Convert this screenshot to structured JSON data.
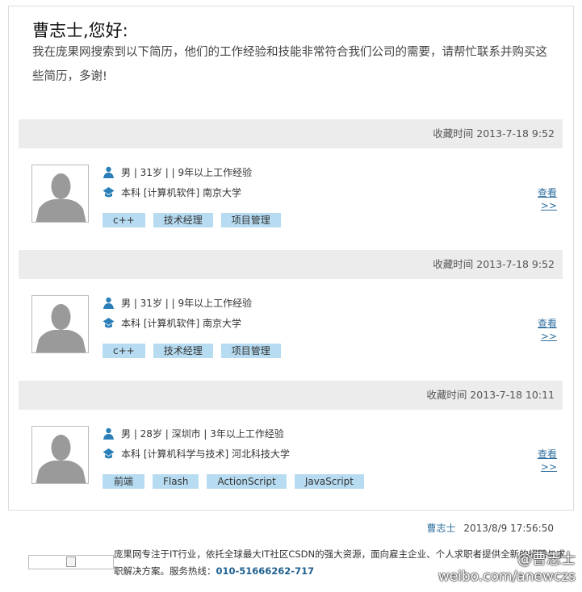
{
  "greeting": "曹志士,您好:",
  "intro": "我在庞果网搜索到以下简历，他们的工作经验和技能非常符合我们公司的需要，请帮忙联系并购买这些简历，多谢!",
  "resumes": [
    {
      "saved_time": "收藏时间 2013-7-18 9:52",
      "profile": "男 | 31岁 | | 9年以上工作经验",
      "education": "本科 [计算机软件] 南京大学",
      "tags": [
        "c++",
        "技术经理",
        "项目管理"
      ],
      "view_label": "查看",
      "view_arrow": ">>"
    },
    {
      "saved_time": "收藏时间 2013-7-18 9:52",
      "profile": "男 | 31岁 | | 9年以上工作经验",
      "education": "本科 [计算机软件] 南京大学",
      "tags": [
        "c++",
        "技术经理",
        "项目管理"
      ],
      "view_label": "查看",
      "view_arrow": ">>"
    },
    {
      "saved_time": "收藏时间 2013-7-18 10:11",
      "profile": "男 | 28岁 | 深圳市 | 3年以上工作经验",
      "education": "本科 [计算机科学与技术] 河北科技大学",
      "tags": [
        "前端",
        "Flash",
        "ActionScript",
        "JavaScript"
      ],
      "view_label": "查看",
      "view_arrow": ">>"
    }
  ],
  "signature": {
    "name": "曹志士",
    "datetime": "2013/8/9 17:56:50"
  },
  "footer": {
    "text": "庞果网专注于IT行业，依托全球最大IT社区CSDN的强大资源，面向雇主企业、个人求职者提供全新的招聘与求职解决方案。服务热线：",
    "phone": "010-51666262-717"
  },
  "watermark": {
    "handle": "@曹志士",
    "url": "weibo.com/anewczs"
  },
  "colors": {
    "tag_bg": "#b7dcf2",
    "link": "#2f6f9f",
    "bar_bg": "#ececec",
    "icon_blue": "#2b7fb8"
  }
}
